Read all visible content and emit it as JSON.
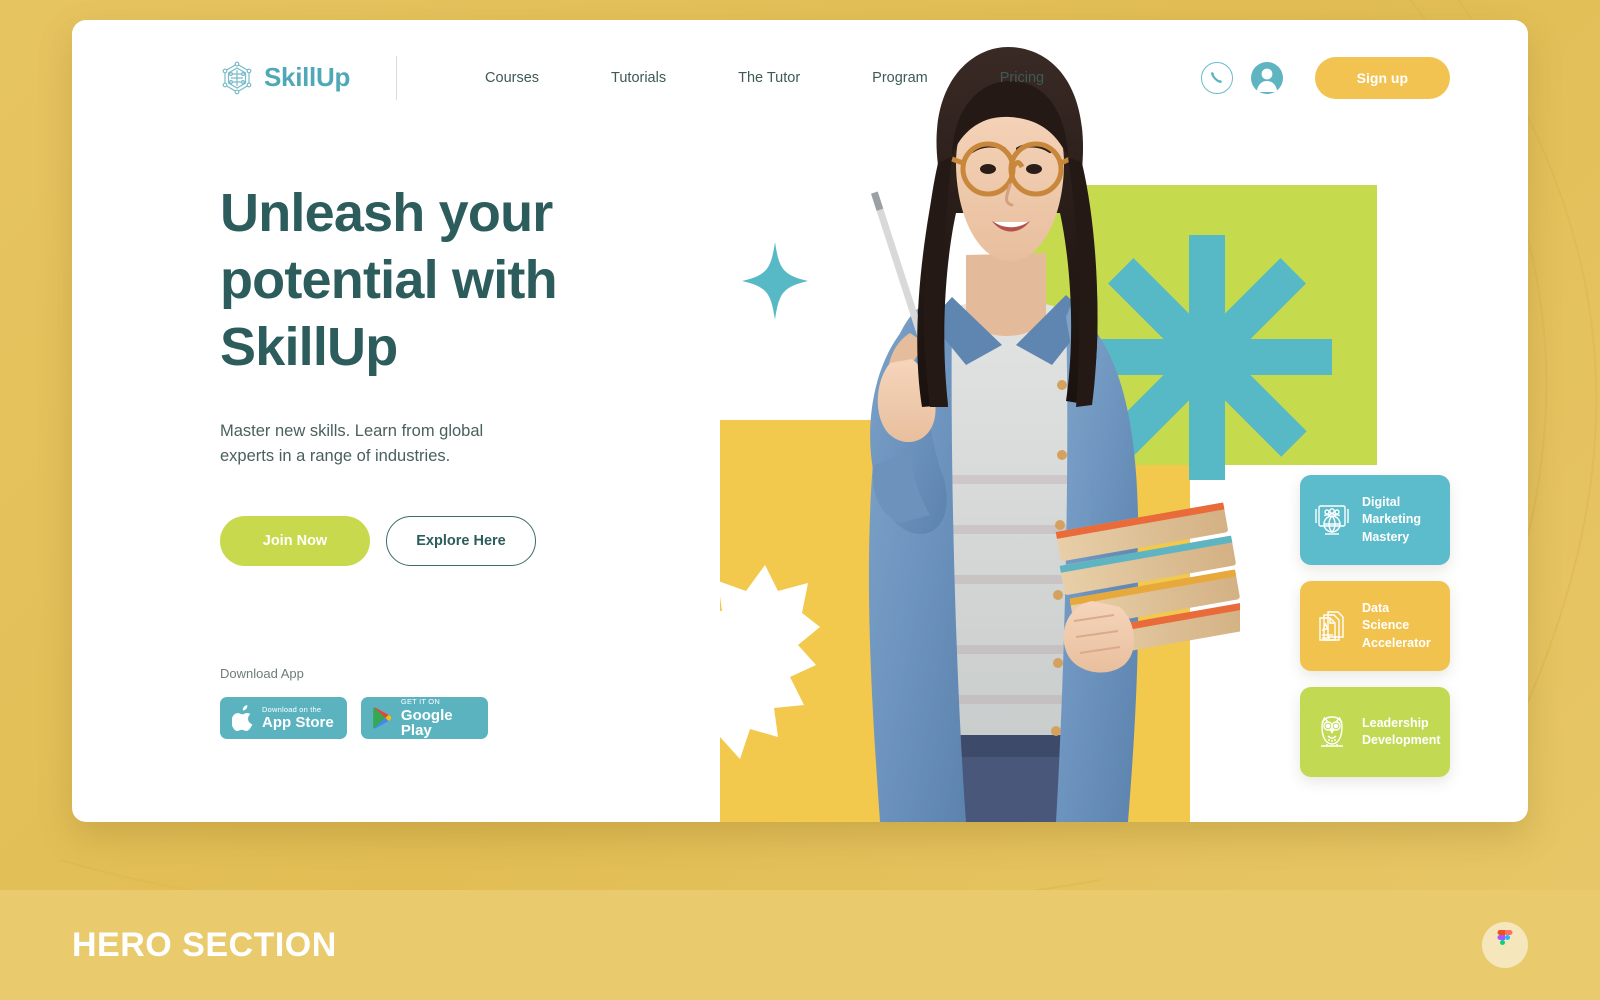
{
  "header": {
    "brand": {
      "name": "SkillUp",
      "logo_icon": "network-node-hexagon-icon",
      "color": "#4fa8b8"
    },
    "nav": [
      {
        "label": "Courses"
      },
      {
        "label": "Tutorials"
      },
      {
        "label": "The Tutor"
      },
      {
        "label": "Program"
      },
      {
        "label": "Pricing"
      }
    ],
    "actions": {
      "phone_icon": "phone-icon",
      "account_icon": "user-avatar-icon",
      "signup_label": "Sign up",
      "signup_color": "#f3c351"
    }
  },
  "hero": {
    "heading": "Unleash your potential with SkillUp",
    "subheading": "Master new skills. Learn from global experts in a range of industries.",
    "primary_cta": "Join Now",
    "secondary_cta": "Explore Here",
    "primary_cta_color": "#c8d94e",
    "download_label": "Download App",
    "store_badges": [
      {
        "small": "Download on the",
        "large": "App Store",
        "icon": "apple-logo-icon"
      },
      {
        "small": "GET IT ON",
        "large": "Google Play",
        "icon": "google-play-icon"
      }
    ]
  },
  "course_cards": [
    {
      "title": "Digital Marketing Mastery",
      "color": "#5cbccb",
      "icon": "globe-people-screen-icon"
    },
    {
      "title": "Data Science Accelerator",
      "color": "#f2c24f",
      "icon": "stacked-documents-icon"
    },
    {
      "title": "Leadership Development",
      "color": "#c2d954",
      "icon": "owl-icon"
    }
  ],
  "artwork": {
    "green_square_color": "#c6da4e",
    "yellow_rect_color": "#f2c94c",
    "asterisk_color": "#57b9c6",
    "sparkle_color": "#57b9c6",
    "starburst_color": "#ffffff",
    "photo_alt": "smiling-student-holding-books"
  },
  "footer": {
    "caption": "HERO SECTION",
    "badge_icon": "figma-logo-icon",
    "background": "#e9ca6d"
  }
}
